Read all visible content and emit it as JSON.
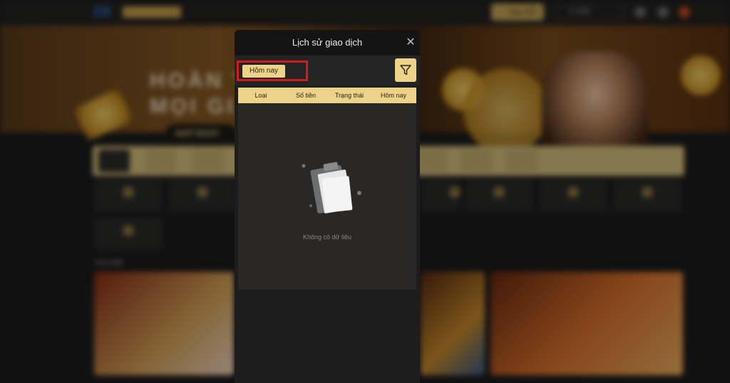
{
  "background": {
    "logo": "Z8",
    "nav": {
      "login_label": "Nạp tiền",
      "balance": "0 VND"
    },
    "banner": {
      "title_line1": "HOÀN T",
      "title_line2": "MỌI GIA",
      "button_label": "NẠP NGAY"
    },
    "section_label": "Hot nhất",
    "colors": {
      "gold": "#edd28a",
      "dark": "#1d1d1d"
    }
  },
  "modal": {
    "title": "Lịch sử giao dịch",
    "close_icon": "close-icon",
    "date_filter": "Hôm nay",
    "filter_icon": "funnel-icon",
    "columns": [
      "Loại",
      "Số tiền",
      "Trạng thái",
      "Hôm nay"
    ],
    "empty_icon": "clipboard-icon",
    "empty_text": "Không có dữ liệu",
    "highlight_color": "#d21c1c"
  }
}
